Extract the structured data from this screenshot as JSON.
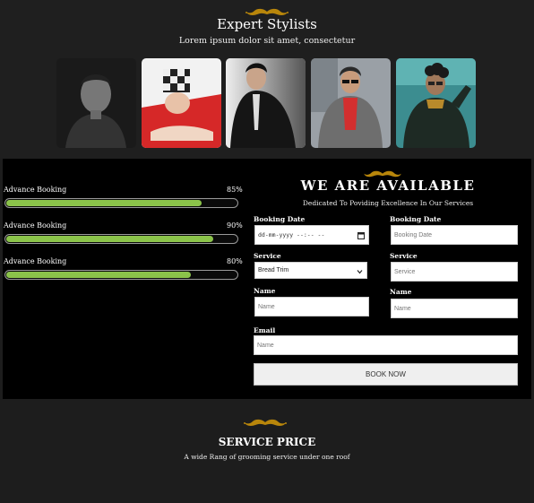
{
  "stylists": {
    "title": "Expert Stylists",
    "subtitle": "Lorem ipsum dolor sit amet, consectetur",
    "photos": [
      "stylist-photo-1",
      "stylist-photo-2",
      "stylist-photo-3",
      "stylist-photo-4",
      "stylist-photo-5"
    ]
  },
  "progress": [
    {
      "label": "Advance Booking",
      "percent_text": "85%",
      "value": 0.85
    },
    {
      "label": "Advance Booking",
      "percent_text": "90%",
      "value": 0.9
    },
    {
      "label": "Advance Booking",
      "percent_text": "80%",
      "value": 0.8
    }
  ],
  "availability": {
    "title": "WE  ARE  AVAILABLE",
    "subtitle": "Dedicated To Poviding Excellence In Our Services",
    "form": {
      "booking_date_label": "Booking Date",
      "booking_date_value": "dd-mm-yyyy --:-- --",
      "booking_date2_label": "Booking Date",
      "booking_date2_placeholder": "Booking Date",
      "service_label": "Service",
      "service_selected": "Bread Trim",
      "service2_label": "Service",
      "service2_placeholder": "Service",
      "name_label": "Name",
      "name_placeholder": "Name",
      "name2_label": "Name",
      "name2_placeholder": "Name",
      "email_label": "Email",
      "email_placeholder": "Name",
      "submit_label": "BOOK NOW"
    }
  },
  "service_price": {
    "title": "SERVICE PRICE",
    "subtitle": "A wide Rang of grooming service under one roof"
  },
  "colors": {
    "accent_gold": "#b8860b",
    "progress_green": "#8bc34a",
    "page_bg": "#1d1d1d",
    "booking_bg": "#000000"
  },
  "icons": [
    "mustache-icon",
    "calendar-icon",
    "chevron-down-icon"
  ]
}
